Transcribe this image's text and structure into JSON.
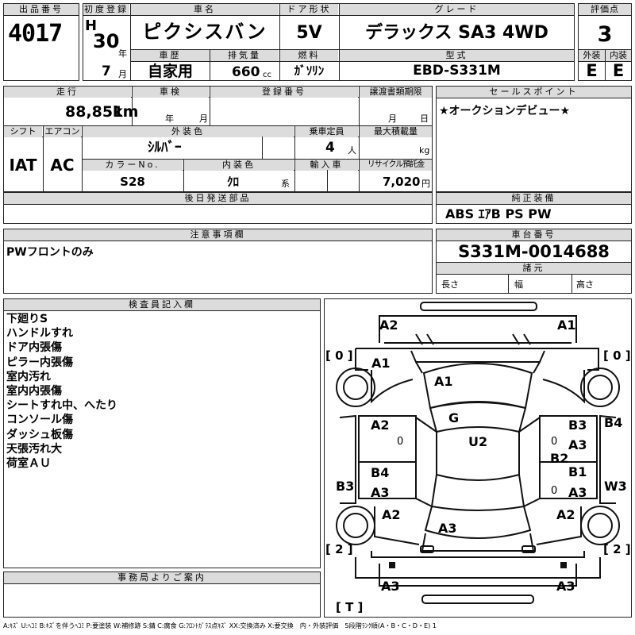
{
  "top": {
    "lot_header": "出品番号",
    "lot_number": "4017",
    "first_reg_header": "初度登録",
    "era": "H",
    "year_num": "30",
    "year_unit": "年",
    "month_num": "7",
    "month_unit": "月",
    "car_name_header": "車名",
    "car_name": "ピクシスバン",
    "history_header": "車歴",
    "history_value": "自家用",
    "displacement_header": "排気量",
    "displacement_value": "660",
    "displacement_unit": "cc",
    "door_header": "ドア形状",
    "door_value": "5V",
    "fuel_header": "燃料",
    "fuel_value": "ｶﾞｿﾘﾝ",
    "grade_header": "グレード",
    "grade_value": "デラックス SA3 4WD",
    "model_header": "型式",
    "model_value": "EBD-S331M",
    "score_header": "評価点",
    "score_value": "3",
    "ext_header": "外装",
    "ext_value": "E",
    "int_header": "内装",
    "int_value": "E"
  },
  "mid": {
    "mileage_header": "走行",
    "mileage_value": "88,851",
    "mileage_unit": "km",
    "inspection_header": "車検",
    "inspection_year_unit": "年",
    "inspection_month_unit": "月",
    "regno_header": "登録番号",
    "transfer_header": "譲渡書類期限",
    "transfer_month_unit": "月",
    "transfer_day_unit": "日",
    "shift_header": "シフト",
    "shift_value": "IAT",
    "aircon_header": "エアコン",
    "aircon_value": "AC",
    "color_header": "外装色",
    "color_value": "ｼﾙﾊﾞｰ",
    "colorno_header": "カラーNo.",
    "colorno_value": "S28",
    "intcolor_header": "内装色",
    "intcolor_value": "ｸﾛ",
    "intcolor_suffix": "系",
    "capacity_header": "乗車定員",
    "capacity_value": "4",
    "capacity_unit": "人",
    "load_header": "最大積載量",
    "load_unit": "kg",
    "import_header": "輸入車",
    "recycle_header": "リサイクル預託金",
    "recycle_value": "7,020",
    "recycle_unit": "円",
    "later_parts_header": "後日発送部品",
    "sales_point_header": "セールスポイント",
    "sales_point_text": "★オークションデビュー★",
    "equip_header": "純正装備",
    "equip_value": "ABS ｴｱB PS PW",
    "caution_header": "注意事項欄",
    "caution_text": "PWフロントのみ",
    "chassis_header": "車台番号",
    "chassis_value": "S331M-0014688",
    "dims_header": "諸元",
    "length_label": "長さ",
    "width_label": "幅",
    "height_label": "高さ"
  },
  "inspector": {
    "header": "検査員記入欄",
    "notes": [
      "下廻りS",
      "ハンドルすれ",
      "ドア内張傷",
      "ピラー内張傷",
      "室内汚れ",
      "室内内張傷",
      "シートすれ中、へたり",
      "コンソール傷",
      "ダッシュ板傷",
      "天張汚れ大",
      "荷室ＡＵ"
    ]
  },
  "office_header": "事務局よりご案内",
  "diagram": {
    "tire_top_left": "[ 0 ]",
    "tire_top_right": "[ 0 ]",
    "tire_bottom_left": "[ 2 ]",
    "tire_bottom_right": "[ 2 ]",
    "spare_tire": "[ T ]",
    "marks": {
      "front_bumper_left": "A2",
      "front_bumper_right": "A1",
      "left_fender": "A1",
      "hood": "A1",
      "windshield": "G",
      "roof": "U2",
      "left_front_door": "A2",
      "left_front_door_zero": "0",
      "left_rear_door_1": "B4",
      "left_rear_door_2": "A3",
      "left_side_panel": "B3",
      "left_quarter": "A2",
      "rear_glass": "A3",
      "right_quarter": "A2",
      "right_front_door_1": "B3",
      "right_front_door_2": "A3",
      "right_front_door_zero": "0",
      "right_pillar": "B2",
      "right_rear_door_1": "B1",
      "right_rear_door_2": "A3",
      "right_rear_door_zero": "0",
      "right_side_top": "B4",
      "right_side_bottom": "W3",
      "rear_bumper_left": "A3",
      "rear_bumper_right": "A3"
    }
  },
  "legend": "A:ｷｽﾞ U:ﾍｺﾐ B:ｷｽﾞを伴うﾍｺﾐ P:要塗装 W:補修跡 S:錆 C:腐食 G:ﾌﾛﾝﾄｶﾞﾗｽ点ｷｽﾞ XX:交換済み X:要交換　内・外装評価　5段階ﾗﾝｸ順(A・B・C・D・E) 1"
}
